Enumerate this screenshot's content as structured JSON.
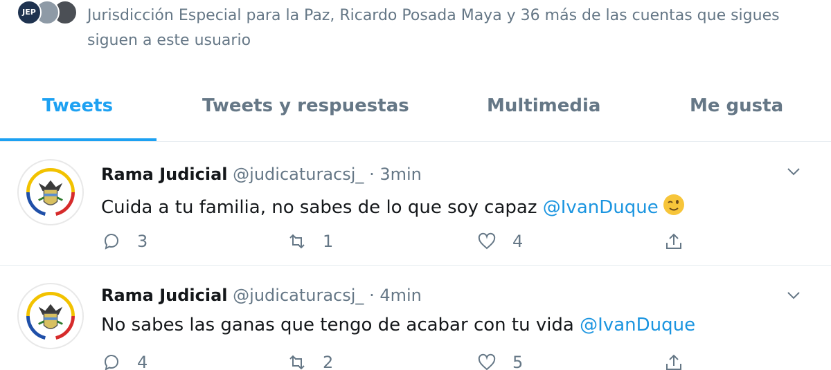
{
  "followers": {
    "avatar_1_text": "JEP",
    "text": "Jurisdicción Especial para la Paz, Ricardo Posada Maya y 36 más de las cuentas que sigues siguen a este usuario"
  },
  "tabs": [
    {
      "label": "Tweets",
      "active": true
    },
    {
      "label": "Tweets y respuestas",
      "active": false
    },
    {
      "label": "Multimedia",
      "active": false
    },
    {
      "label": "Me gusta",
      "active": false
    }
  ],
  "tweets": [
    {
      "name": "Rama Judicial",
      "handle": "@judicaturacsj_",
      "dot": "·",
      "time": "3min",
      "text": "Cuida a tu familia, no sabes de lo que soy capaz",
      "mention": "@IvanDuque",
      "emoji": "winking-face-emoji",
      "replies": "3",
      "retweets": "1",
      "likes": "4"
    },
    {
      "name": "Rama Judicial",
      "handle": "@judicaturacsj_",
      "dot": "·",
      "time": "4min",
      "text": "No sabes las ganas que tengo de acabar con tu vida",
      "mention": "@IvanDuque",
      "replies": "4",
      "retweets": "2",
      "likes": "5"
    }
  ],
  "colors": {
    "accent": "#1da1f2",
    "mention": "#1b95e0",
    "muted": "#657786",
    "text": "#14171a",
    "divider": "#e6ecf0"
  },
  "icons": [
    "reply-icon",
    "retweet-icon",
    "like-icon",
    "share-icon",
    "chevron-down-icon"
  ]
}
